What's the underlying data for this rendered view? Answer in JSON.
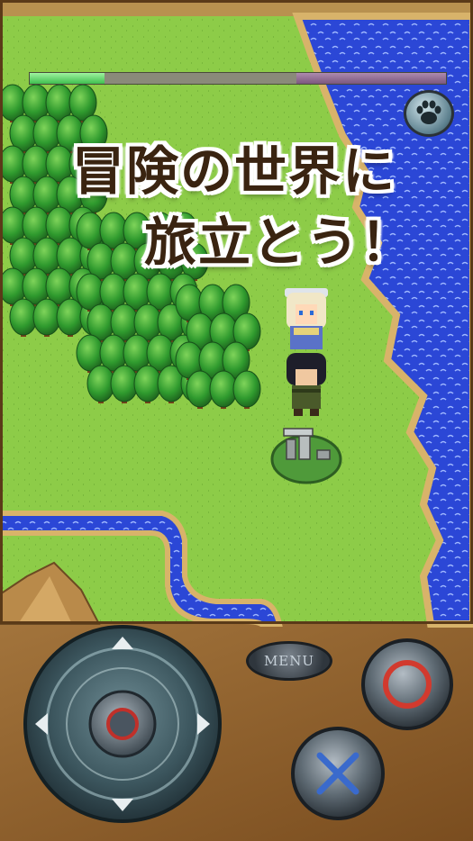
{
  "banner": {
    "line1": "冒険の世界に",
    "line2": "旅立とう！"
  },
  "status": {
    "progress": 0.18
  },
  "controls": {
    "menu_label": "MENU",
    "dpad_icon": "directional-pad",
    "confirm_icon": "circle",
    "cancel_icon": "cross",
    "top_right_icon": "paw"
  },
  "colors": {
    "grass": "#8fd04a",
    "water": "#2f4fe0",
    "forest": "#2f8f2a"
  }
}
